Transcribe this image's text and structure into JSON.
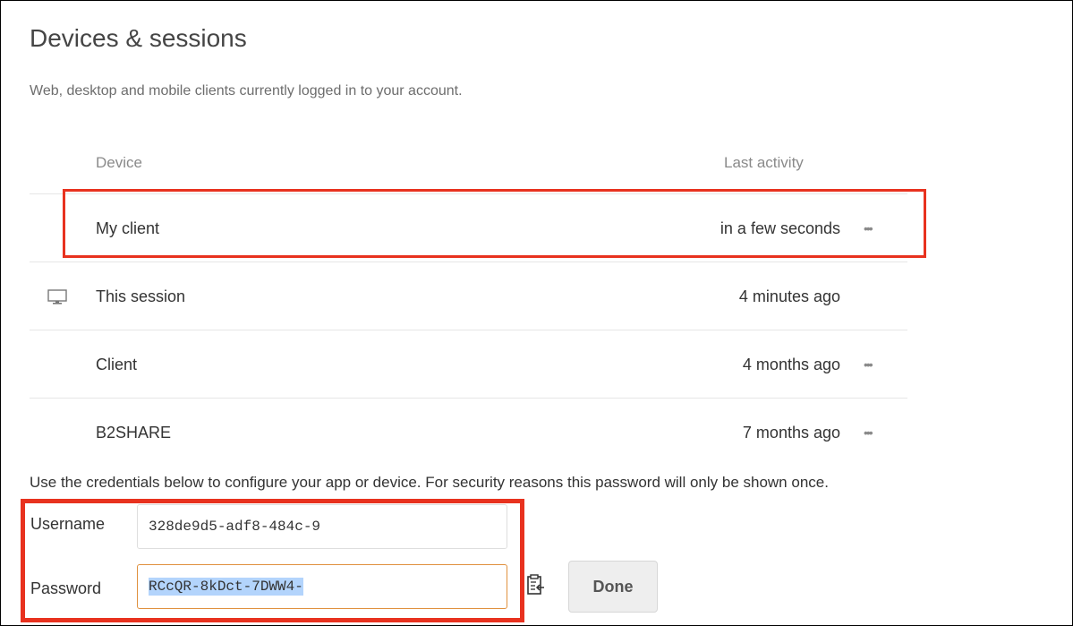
{
  "page": {
    "title": "Devices & sessions",
    "subtitle": "Web, desktop and mobile clients currently logged in to your account."
  },
  "table": {
    "columns": {
      "device": "Device",
      "last_activity": "Last activity"
    },
    "rows": [
      {
        "name": "My client",
        "last_activity": "in a few seconds",
        "has_menu": true,
        "icon": ""
      },
      {
        "name": "This session",
        "last_activity": "4 minutes ago",
        "has_menu": false,
        "icon": "monitor-icon"
      },
      {
        "name": "Client",
        "last_activity": "4 months ago",
        "has_menu": true,
        "icon": ""
      },
      {
        "name": "B2SHARE",
        "last_activity": "7 months ago",
        "has_menu": true,
        "icon": ""
      }
    ],
    "menu_glyph": "•••"
  },
  "credentials": {
    "info": "Use the credentials below to configure your app or device. For security reasons this password will only be shown once.",
    "username_label": "Username",
    "username_value": "328de9d5-adf8-484c-9",
    "password_label": "Password",
    "password_value": "RCcQR-8kDct-7DWW4-",
    "done_label": "Done"
  },
  "colors": {
    "highlight": "#e8321f",
    "field_focus": "#e0913e",
    "selection": "#b3d4fc"
  }
}
